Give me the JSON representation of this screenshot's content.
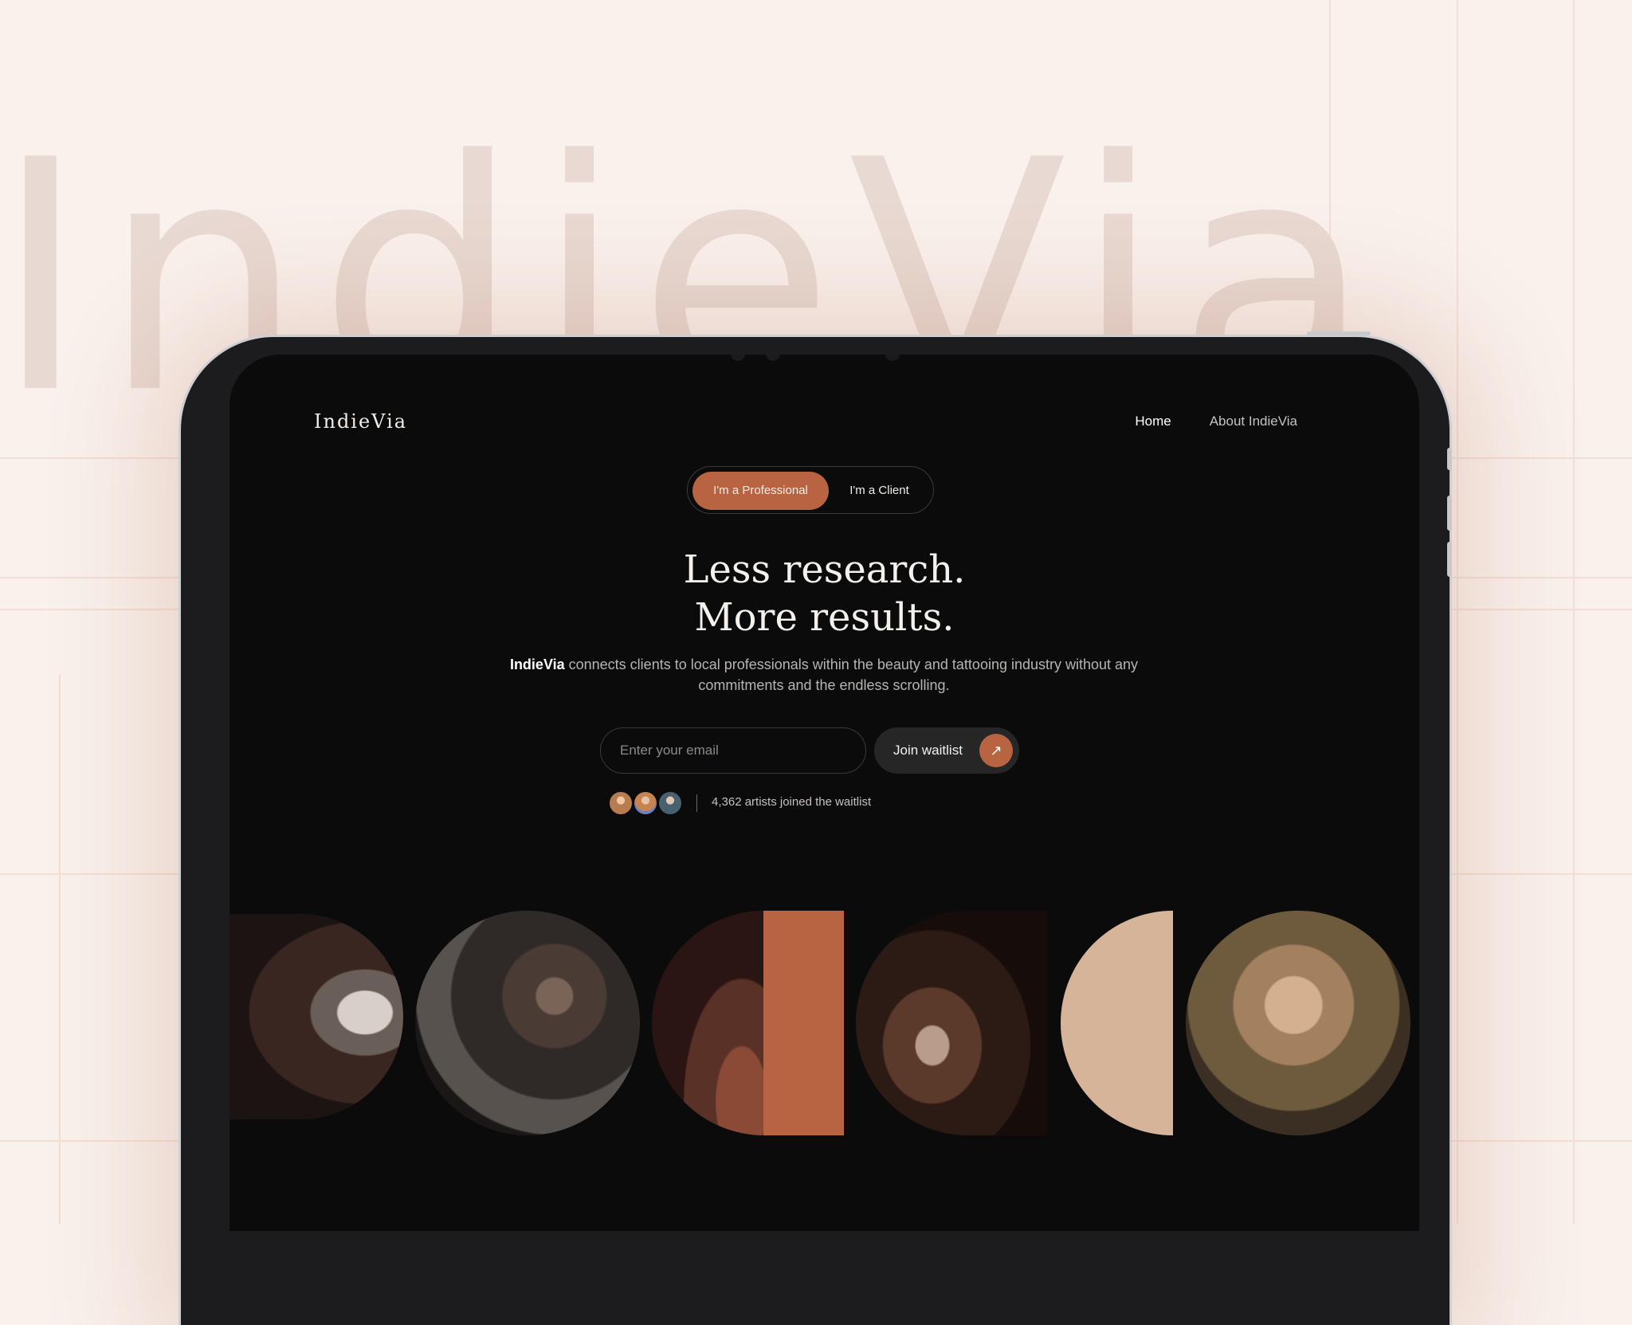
{
  "background": {
    "brand_word": "IndieVia"
  },
  "header": {
    "logo": "IndieVia",
    "nav": {
      "home": "Home",
      "about": "About IndieVia"
    }
  },
  "toggle": {
    "professional": "I'm a Professional",
    "client": "I'm a Client"
  },
  "hero": {
    "line1": "Less research.",
    "line2": "More results.",
    "brand": "IndieVia",
    "description": " connects clients to local professionals within the beauty and tattooing industry without any commitments and the endless scrolling."
  },
  "waitlist": {
    "placeholder": "Enter your email",
    "button": "Join waitlist",
    "arrow": "↗",
    "joined_text": "4,362 artists joined the waitlist"
  },
  "gallery": {
    "items": [
      "tattoo-artist-hand-photo",
      "tattooed-woman-photo",
      "tattoo-closeup-photo",
      "tattoo-artist-working-photo",
      "tattooed-hand-photo"
    ]
  },
  "colors": {
    "accent": "#b96441",
    "page_background": "#f9f1ec",
    "screen_background": "#0b0b0b",
    "beige": "#d6b49a"
  }
}
